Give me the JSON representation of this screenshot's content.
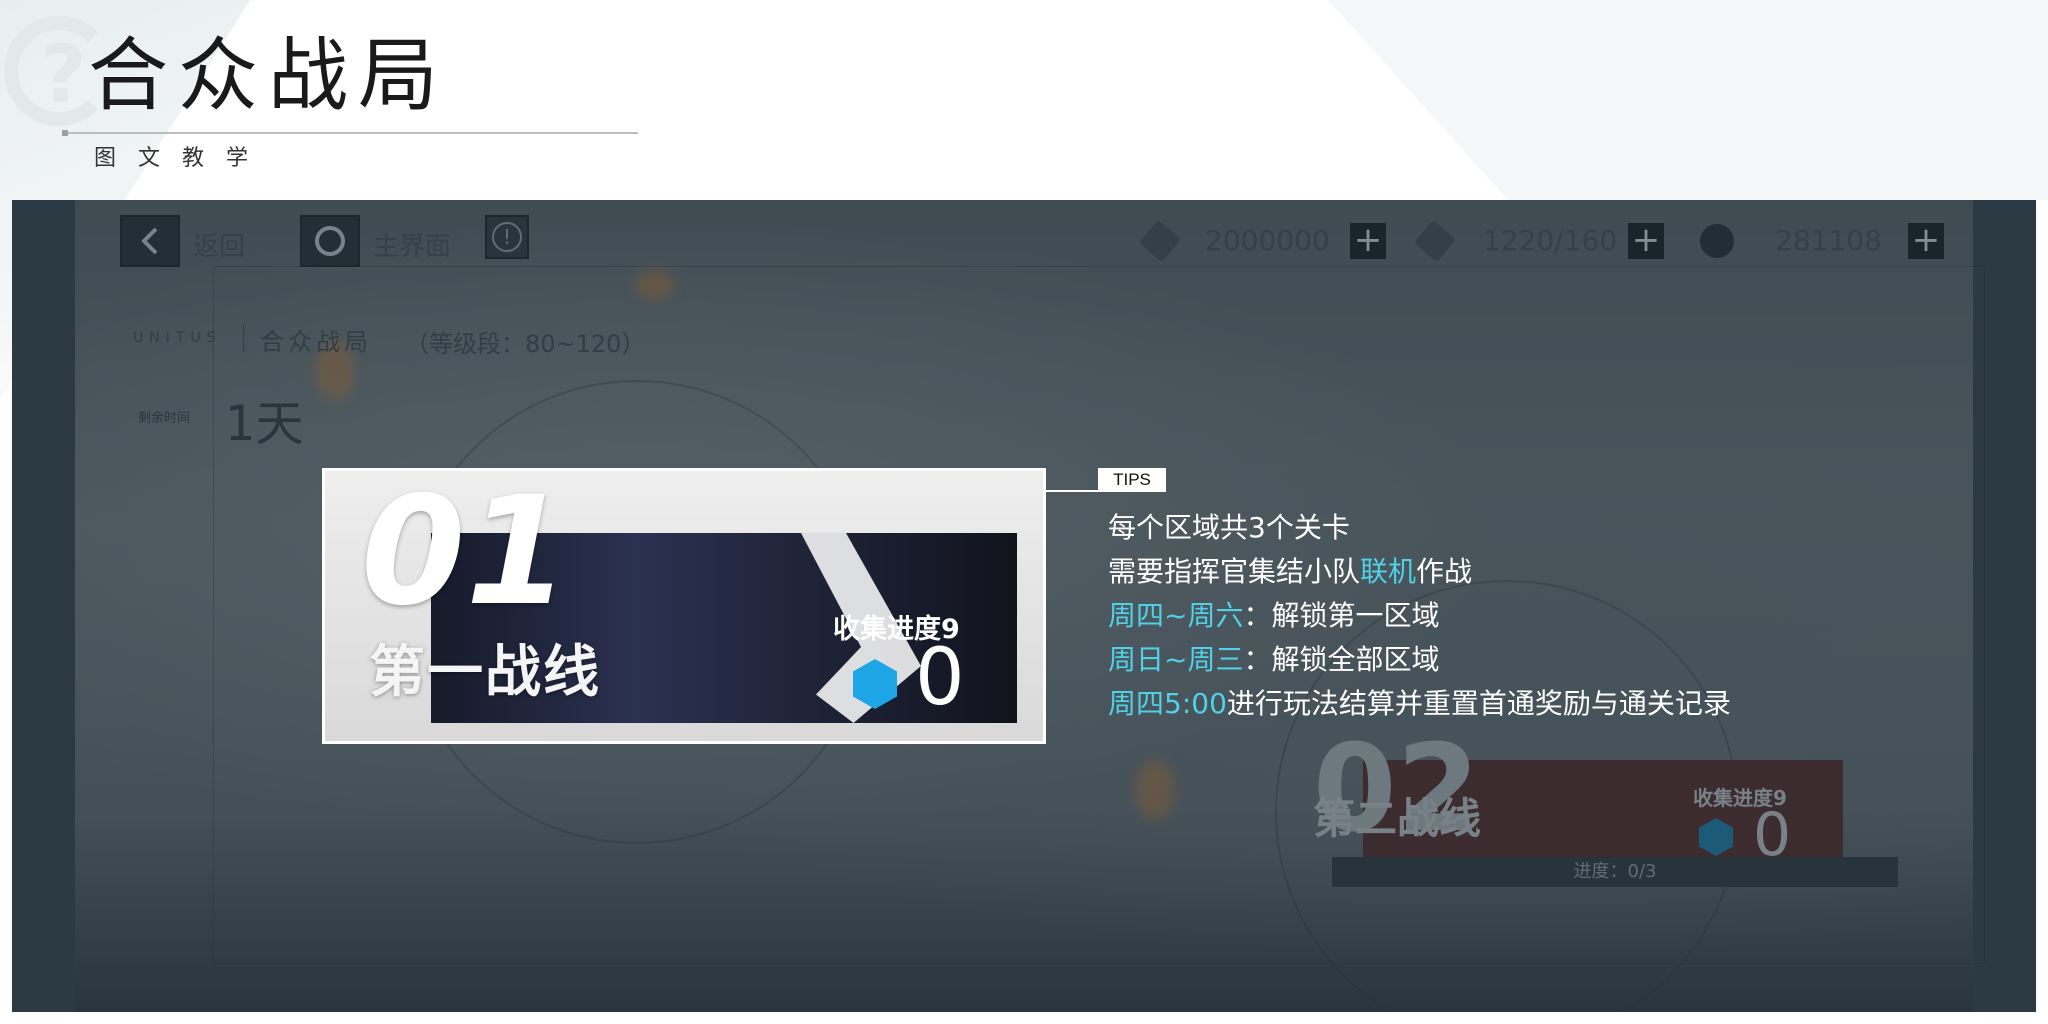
{
  "header": {
    "title": "合众战局",
    "subtitle": "图文教学",
    "help_glyph": "?"
  },
  "game": {
    "topbar": {
      "back_label": "返回",
      "home_label": "主界面",
      "alert_glyph": "!",
      "resources": [
        {
          "icon": "ticket-icon",
          "value": "2000000"
        },
        {
          "icon": "fuel-icon",
          "value": "1220/160"
        },
        {
          "icon": "coin-icon",
          "value": "281108"
        }
      ],
      "plus_glyph": "+"
    },
    "event": {
      "tag": "UNITUS",
      "name": "合众战局",
      "level_range": "（等级段：80~120）",
      "remaining_label": "剩余时间",
      "remaining_value": "1天"
    },
    "cards": [
      {
        "number": "01",
        "name": "第一战线",
        "collect_label": "收集进度9",
        "collect_count": "0"
      },
      {
        "number": "02",
        "name": "第二战线",
        "collect_label": "收集进度9",
        "collect_count": "0",
        "progress": "进度：0/3"
      }
    ]
  },
  "tips": {
    "badge": "TIPS",
    "highlight_color": "#4fd1e8",
    "lines": [
      {
        "plain": "每个区域共3个关卡"
      },
      {
        "pre": "需要指挥官集结小队",
        "hl": "联机",
        "post": "作战"
      },
      {
        "hl": "周四~周六",
        "post": "：解锁第一区域"
      },
      {
        "hl": "周日~周三",
        "post": "：解锁全部区域"
      },
      {
        "hl": "周四5:00",
        "post": "进行玩法结算并重置首通奖励与通关记录"
      }
    ]
  }
}
